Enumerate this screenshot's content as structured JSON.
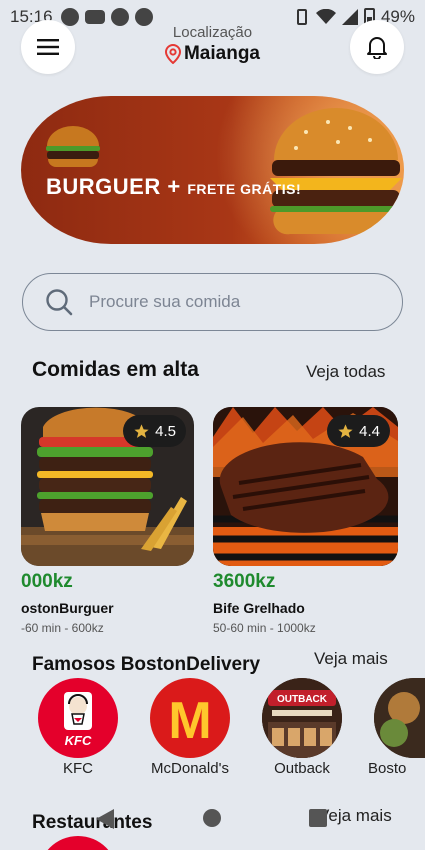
{
  "status": {
    "time": "15:16",
    "battery": "49%"
  },
  "header": {
    "location_label": "Localização",
    "location_name": "Maianga"
  },
  "banner": {
    "headline_main": "BURGUER +",
    "headline_sub": "FRETE GRÁTIS!"
  },
  "search": {
    "placeholder": "Procure sua comida"
  },
  "trending": {
    "title": "Comidas em alta",
    "link": "Veja todas",
    "items": [
      {
        "rating": "4.5",
        "price": "000kz",
        "name": "ostonBurguer",
        "meta": "-60 min - 600kz"
      },
      {
        "rating": "4.4",
        "price": "3600kz",
        "name": "Bife Grelhado",
        "meta": "50-60 min - 1000kz"
      }
    ]
  },
  "famous": {
    "title": "Famosos BostonDelivery",
    "link": "Veja mais",
    "brands": [
      {
        "name": "KFC",
        "logo_text": "KFC"
      },
      {
        "name": "McDonald's",
        "logo_text": "M"
      },
      {
        "name": "Outback",
        "logo_text": "OUTBACK"
      },
      {
        "name": "Bosto"
      }
    ]
  },
  "restaurants": {
    "title": "Restaurantes",
    "link": "Veja mais"
  },
  "colors": {
    "accent_green": "#1f8a2e",
    "pin_red": "#e53935",
    "background": "#e4e8ee"
  }
}
